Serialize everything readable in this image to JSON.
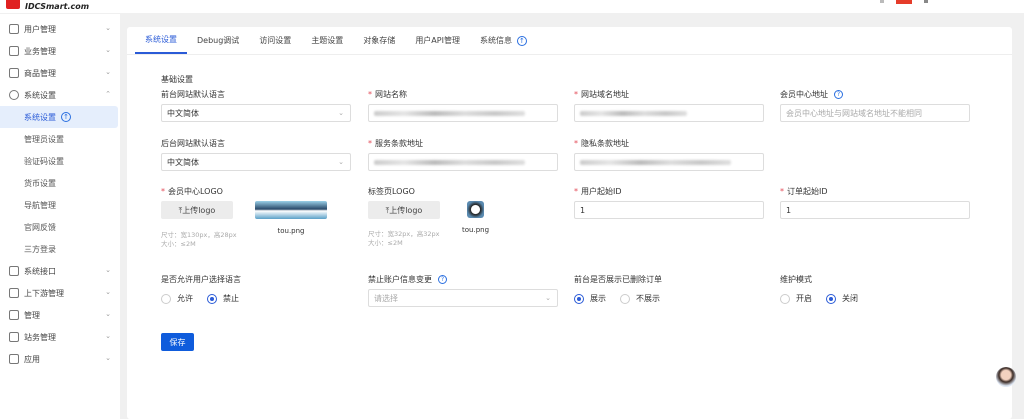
{
  "brand": {
    "logo_text": "IDCSmart.com",
    "accent": "#2a5bd7"
  },
  "sidebar": {
    "items": [
      {
        "label": "用户管理",
        "icon": "user-icon"
      },
      {
        "label": "业务管理",
        "icon": "document-icon"
      },
      {
        "label": "商品管理",
        "icon": "cart-icon"
      },
      {
        "label": "系统设置",
        "icon": "gear-icon",
        "expanded": true,
        "children": [
          "系统设置",
          "管理员设置",
          "验证码设置",
          "货币设置",
          "导航管理",
          "官网反馈",
          "三方登录"
        ]
      },
      {
        "label": "系统接口",
        "icon": "folder-icon"
      },
      {
        "label": "上下游管理",
        "icon": "network-icon"
      },
      {
        "label": "管理",
        "icon": "spark-icon"
      },
      {
        "label": "站务管理",
        "icon": "folder-plus-icon"
      },
      {
        "label": "应用",
        "icon": "box-icon"
      }
    ]
  },
  "tabs": [
    "系统设置",
    "Debug调试",
    "访问设置",
    "主题设置",
    "对象存储",
    "用户API管理",
    "系统信息"
  ],
  "form": {
    "section_title": "基础设置",
    "front_lang": {
      "label": "前台网站默认语言",
      "value": "中文简体"
    },
    "site_name": {
      "label": "网站名称"
    },
    "site_domain": {
      "label": "网站域名地址"
    },
    "member_url": {
      "label": "会员中心地址",
      "placeholder": "会员中心地址与网站域名地址不能相同"
    },
    "admin_lang": {
      "label": "后台网站默认语言",
      "value": "中文简体"
    },
    "terms_url": {
      "label": "服务条款地址"
    },
    "privacy_url": {
      "label": "隐私条款地址"
    },
    "member_logo": {
      "label": "会员中心LOGO",
      "button": "⤒上传logo",
      "file": "tou.png",
      "hint1": "尺寸：宽130px，高28px",
      "hint2": "大小：≤2M"
    },
    "tab_logo": {
      "label": "标签页LOGO",
      "button": "⤒上传logo",
      "file": "tou.png",
      "hint1": "尺寸：宽32px，高32px",
      "hint2": "大小：≤2M"
    },
    "user_start_id": {
      "label": "用户起始ID",
      "value": "1"
    },
    "order_start_id": {
      "label": "订单起始ID",
      "value": "1"
    },
    "allow_lang": {
      "label": "是否允许用户选择语言",
      "options": [
        "允许",
        "禁止"
      ],
      "selected": "禁止"
    },
    "forbid_change": {
      "label": "禁止账户信息变更",
      "placeholder": "请选择"
    },
    "show_deleted": {
      "label": "前台是否展示已删除订单",
      "options": [
        "展示",
        "不展示"
      ],
      "selected": "展示"
    },
    "maintenance": {
      "label": "维护模式",
      "options": [
        "开启",
        "关闭"
      ],
      "selected": "关闭"
    },
    "save": "保存"
  }
}
